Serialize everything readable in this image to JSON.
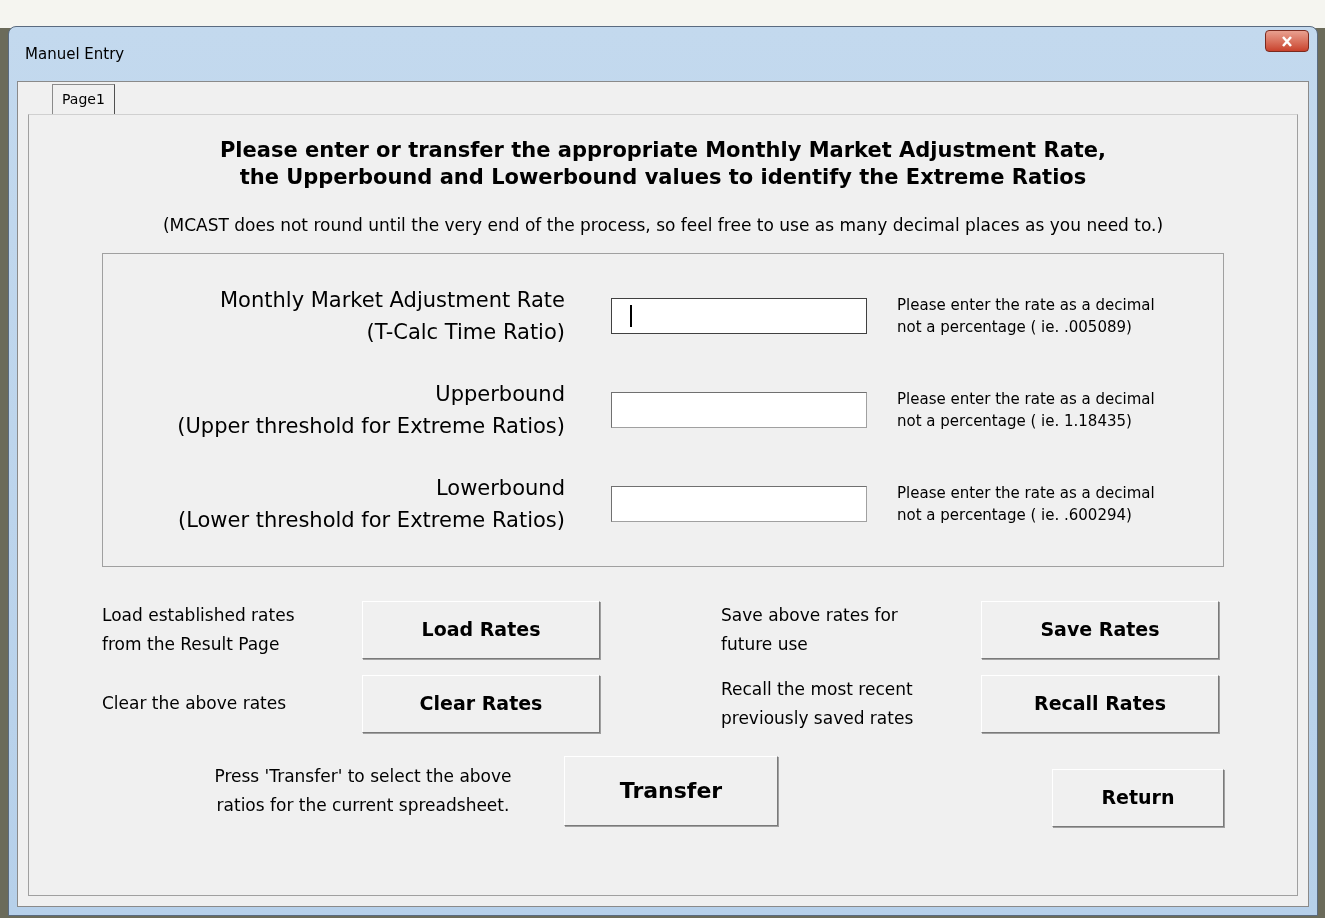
{
  "window": {
    "title": "Manuel Entry"
  },
  "tabs": [
    {
      "label": "Page1",
      "selected": true
    }
  ],
  "heading": [
    "Please enter or transfer the appropriate Monthly Market Adjustment Rate,",
    "the Upperbound and Lowerbound values to identify the Extreme Ratios"
  ],
  "note": "(MCAST does not round until the very end of the process, so feel free to use as many decimal places as you need to.)",
  "fields": [
    {
      "label": "Monthly Market Adjustment Rate",
      "sublabel": "(T-Calc Time Ratio)",
      "focused": true,
      "hint": [
        "Please enter the rate as a decimal",
        "not a percentage ( ie. .005089)"
      ]
    },
    {
      "label": "Upperbound",
      "sublabel": "(Upper threshold for Extreme Ratios)",
      "focused": false,
      "hint": [
        "Please enter the rate as a decimal",
        "not a percentage ( ie. 1.18435)"
      ]
    },
    {
      "label": "Lowerbound",
      "sublabel": "(Lower threshold for Extreme Ratios)",
      "focused": false,
      "hint": [
        "Please enter the rate as a decimal",
        "not a percentage ( ie. .600294)"
      ]
    }
  ],
  "action_rows": [
    {
      "items": [
        {
          "description": [
            "Load established rates",
            "from the Result Page"
          ],
          "button": "Load Rates"
        },
        {
          "description": [
            "Save above rates for",
            "future use"
          ],
          "button": "Save Rates"
        }
      ]
    },
    {
      "items": [
        {
          "description": [
            "Clear the above rates"
          ],
          "button": "Clear Rates"
        },
        {
          "description": [
            "Recall the most recent",
            "previously saved rates"
          ],
          "button": "Recall Rates"
        }
      ]
    }
  ],
  "transfer": {
    "description": [
      "Press 'Transfer' to select the above",
      "ratios for the current spreadsheet."
    ],
    "button": "Transfer"
  },
  "return_button": "Return"
}
